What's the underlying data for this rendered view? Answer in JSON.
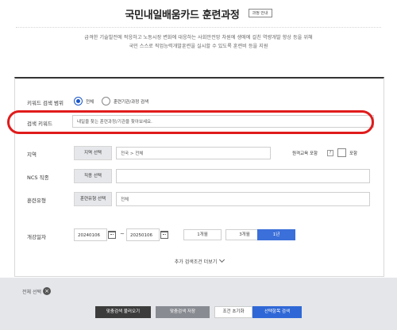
{
  "header": {
    "title": "국민내일배움카드 훈련과정",
    "tag": "과정 안내"
  },
  "description": {
    "line1": "급격한 기술발전에 적응하고 노동시장 변화에 대응하는 사회안전망 차원에 생애에 걸친 역량개발 향상 등을 위해",
    "line2": "국민 스스로 직업능력개발훈련을 실시할 수 있도록 훈련비 등을 지원"
  },
  "search": {
    "keyword_scope_label": "키워드 검색 범위",
    "scope_options": [
      {
        "label": "전체",
        "selected": true
      },
      {
        "label": "훈련기관/과정 검색",
        "selected": false
      }
    ],
    "keyword_label": "검색 키워드",
    "keyword_placeholder": "내일을 찾는 훈련과정/기관을 찾아보세요.",
    "region_label": "지역",
    "region_button": "지역 선택",
    "region_value": "전국 > 전체",
    "include_online_label": "원격교육 포함",
    "include_online_help": "?",
    "include_online_option": "포함",
    "ncs_label": "NCS 직종",
    "ncs_button": "직종 선택",
    "ncs_value": "",
    "training_type_label": "훈련유형",
    "training_type_button": "훈련유형 선택",
    "training_type_value": "전체",
    "start_date_label": "개강일자",
    "date_from": "20240106",
    "date_sep": "~",
    "date_to": "20250106",
    "periods": [
      {
        "label": "1개월",
        "active": false
      },
      {
        "label": "3개월",
        "active": false
      },
      {
        "label": "1년",
        "active": true
      }
    ],
    "more_conditions": "추가 검색조건 더보기"
  },
  "footer": {
    "reset_all": "전체 선택",
    "reset_icon": "×",
    "buttons": [
      "맞춤검색 불러오기",
      "맞춤검색 저장",
      "조건 초기화",
      "선택항목 검색"
    ]
  },
  "colors": {
    "accent": "#2f68d6",
    "highlight": "#e01b1b",
    "bottom_bar": "#e4e6ea"
  }
}
